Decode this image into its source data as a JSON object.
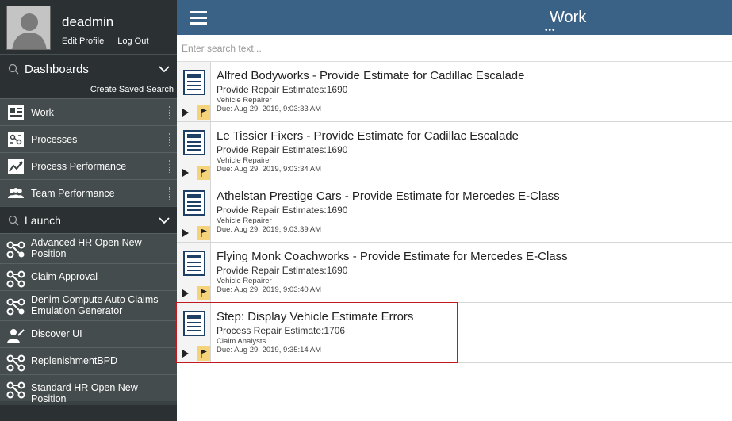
{
  "profile": {
    "username": "deadmin",
    "edit_profile": "Edit Profile",
    "log_out": "Log Out"
  },
  "dashboards": {
    "title": "Dashboards",
    "create_saved_search": "Create Saved Search",
    "items": [
      {
        "label": "Work",
        "icon": "work-list-icon"
      },
      {
        "label": "Processes",
        "icon": "processes-icon"
      },
      {
        "label": "Process Performance",
        "icon": "trend-chart-icon"
      },
      {
        "label": "Team Performance",
        "icon": "team-icon"
      }
    ]
  },
  "launch": {
    "title": "Launch",
    "items": [
      {
        "label": "Advanced HR Open New Position",
        "icon": "process-flow-icon"
      },
      {
        "label": "Claim Approval",
        "icon": "process-flow-icon"
      },
      {
        "label": "Denim Compute Auto Claims - Emulation Generator",
        "icon": "process-flow-icon"
      },
      {
        "label": "Discover UI",
        "icon": "discover-person-icon"
      },
      {
        "label": "ReplenishmentBPD",
        "icon": "process-flow-icon"
      },
      {
        "label": "Standard HR Open New Position",
        "icon": "process-flow-icon"
      }
    ]
  },
  "header": {
    "title": "Work",
    "dots": "•••"
  },
  "search": {
    "placeholder": "Enter search text..."
  },
  "tasks": [
    {
      "name": "Alfred Bodyworks - Provide Estimate for Cadillac Escalade",
      "sub": "Provide Repair Estimates:1690",
      "role": "Vehicle Repairer",
      "due": "Due: Aug 29, 2019, 9:03:33 AM"
    },
    {
      "name": "Le Tissier Fixers - Provide Estimate for Cadillac Escalade",
      "sub": "Provide Repair Estimates:1690",
      "role": "Vehicle Repairer",
      "due": "Due: Aug 29, 2019, 9:03:34 AM"
    },
    {
      "name": "Athelstan Prestige Cars - Provide Estimate for Mercedes E-Class",
      "sub": "Provide Repair Estimates:1690",
      "role": "Vehicle Repairer",
      "due": "Due: Aug 29, 2019, 9:03:39 AM"
    },
    {
      "name": "Flying Monk Coachworks - Provide Estimate for Mercedes E-Class",
      "sub": "Provide Repair Estimates:1690",
      "role": "Vehicle Repairer",
      "due": "Due: Aug 29, 2019, 9:03:40 AM"
    },
    {
      "name": "Step: Display Vehicle Estimate Errors",
      "sub": "Process Repair Estimate:1706",
      "role": "Claim Analysts",
      "due": "Due: Aug 29, 2019, 9:35:14 AM"
    }
  ],
  "colors": {
    "sidebar_bg": "#3a4142",
    "header_bg": "#3a6186",
    "flag_bg": "#f5d37a",
    "selection_border": "#c0191e"
  }
}
